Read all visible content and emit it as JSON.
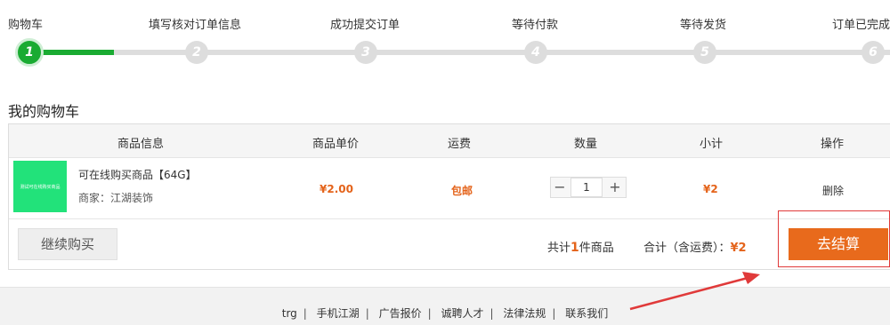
{
  "steps": [
    {
      "label": "购物车",
      "num": "1"
    },
    {
      "label": "填写核对订单信息",
      "num": "2"
    },
    {
      "label": "成功提交订单",
      "num": "3"
    },
    {
      "label": "等待付款",
      "num": "4"
    },
    {
      "label": "等待发货",
      "num": "5"
    },
    {
      "label": "订单已完成",
      "num": "6"
    }
  ],
  "active_step": 1,
  "cart_title": "我的购物车",
  "table_headers": {
    "info": "商品信息",
    "price": "商品单价",
    "shipping": "运费",
    "qty": "数量",
    "subtotal": "小计",
    "action": "操作"
  },
  "item": {
    "thumb_text": "测试可在线购买商品",
    "name": "可在线购买商品【64G】",
    "seller": "商家：江湖装饰",
    "price": "¥2.00",
    "shipping": "包邮",
    "qty_minus": "−",
    "qty": "1",
    "qty_plus": "+",
    "subtotal": "¥2",
    "delete": "删除"
  },
  "footer_row": {
    "continue": "继续购买",
    "count_pre": "共计",
    "count": "1",
    "count_post": "件商品",
    "total_label": "合计（含运费）：",
    "total": "¥2",
    "checkout": "去结算"
  },
  "footer_links": [
    "trg",
    "手机江湖",
    "广告报价",
    "诚聘人才",
    "法律法规",
    "联系我们"
  ],
  "colors": {
    "accent": "#e86a1c",
    "progress": "#1aab32",
    "annotation": "#e03a3a"
  }
}
